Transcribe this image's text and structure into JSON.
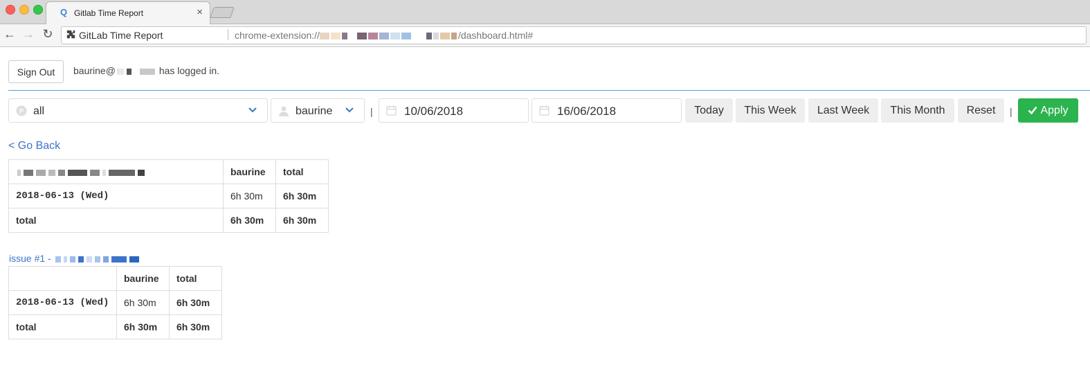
{
  "browser": {
    "tab_title": "Gitlab Time Report",
    "tab_close": "×",
    "site_name": "GitLab Time Report",
    "url_prefix": "chrome-extension://",
    "url_suffix": "/dashboard.html#"
  },
  "header": {
    "sign_out_label": "Sign Out",
    "login_user": "baurine@",
    "login_suffix": "has logged in."
  },
  "filters": {
    "project": "all",
    "user": "baurine",
    "separator": "|",
    "start_date": "10/06/2018",
    "end_date": "16/06/2018",
    "quick_buttons": {
      "today": "Today",
      "this_week": "This Week",
      "last_week": "Last Week",
      "this_month": "This Month",
      "reset": "Reset"
    },
    "apply_label": "Apply"
  },
  "go_back": "< Go Back",
  "project_table": {
    "columns": [
      "baurine",
      "total"
    ],
    "rows": [
      {
        "label": "2018-06-13 (Wed)",
        "values": [
          "6h 30m",
          "6h 30m"
        ]
      },
      {
        "label": "total",
        "values": [
          "6h 30m",
          "6h 30m"
        ]
      }
    ]
  },
  "issue_section": {
    "link_text": "issue #1 -",
    "table": {
      "columns": [
        "baurine",
        "total"
      ],
      "rows": [
        {
          "label": "2018-06-13 (Wed)",
          "values": [
            "6h 30m",
            "6h 30m"
          ]
        },
        {
          "label": "total",
          "values": [
            "6h 30m",
            "6h 30m"
          ]
        }
      ]
    }
  },
  "colors": {
    "accent": "#3b74c9",
    "apply_green": "#2bb34e",
    "divider": "#5b9bd5"
  }
}
